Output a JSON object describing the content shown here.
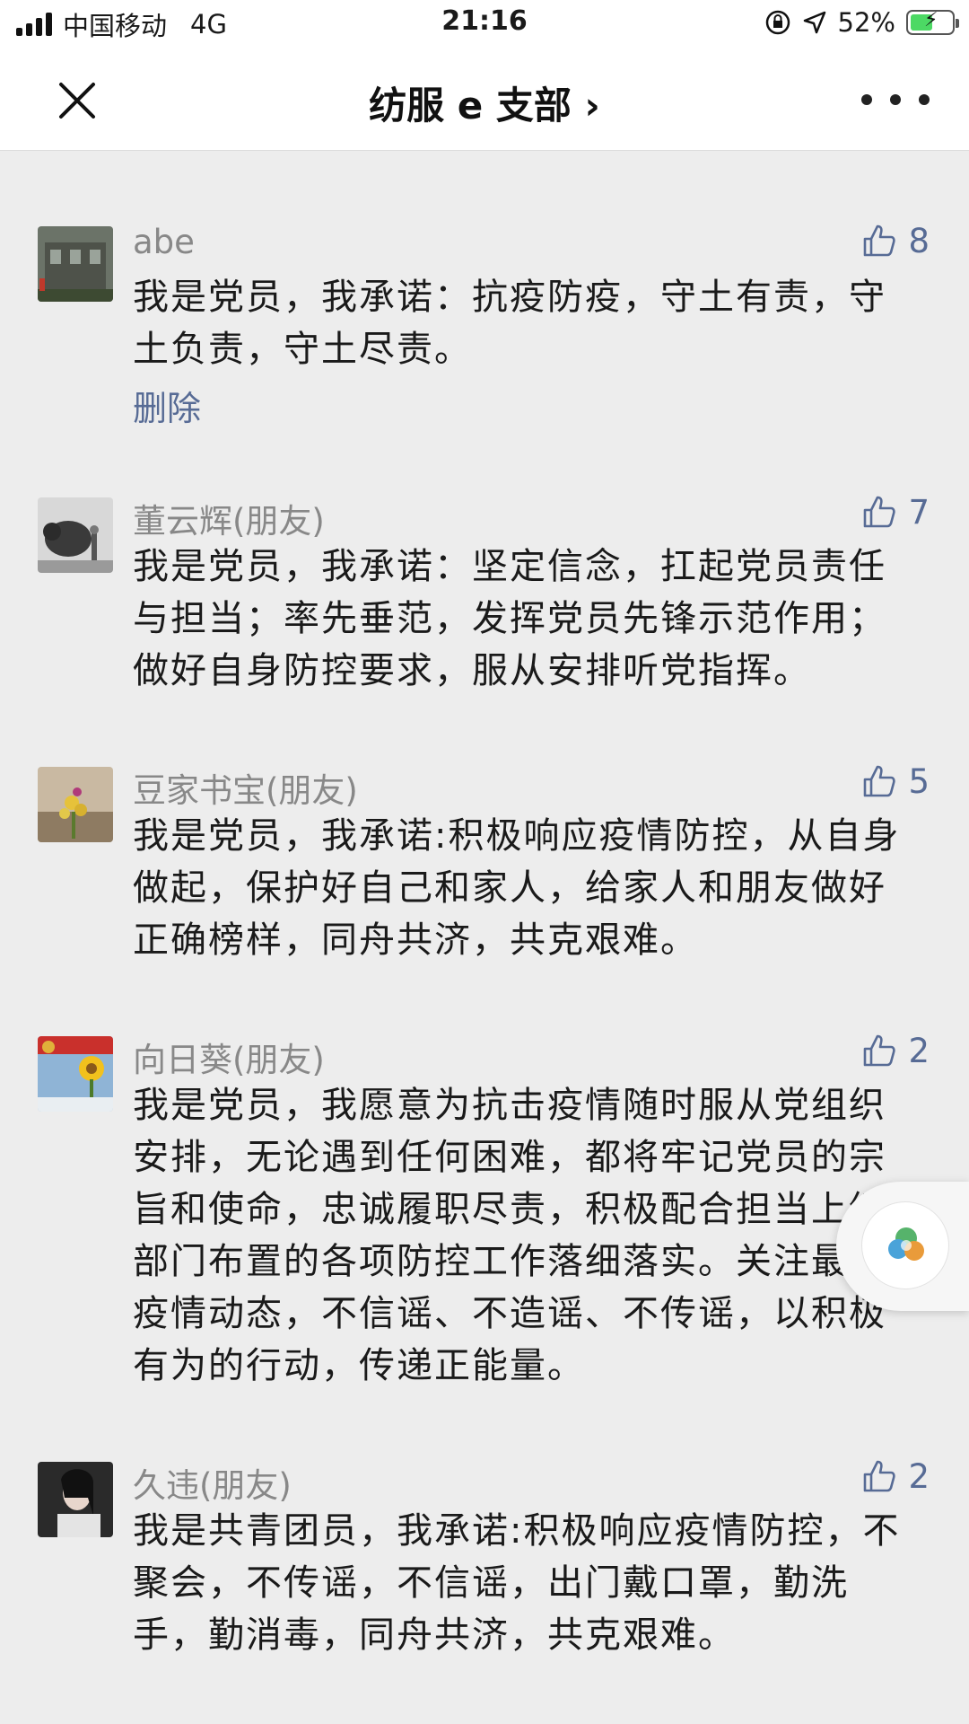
{
  "status_bar": {
    "carrier": "中国移动",
    "network": "4G",
    "time": "21:16",
    "battery": "52%",
    "battery_level": 0.52
  },
  "nav": {
    "title": "纺服 e 支部 ›"
  },
  "comments": [
    {
      "name": "abe",
      "likes": "8",
      "text": "我是党员，我承诺：抗疫防疫，守土有责，守土负责，守土尽责。",
      "delete_label": "删除"
    },
    {
      "name": "董云辉(朋友)",
      "likes": "7",
      "text": "我是党员，我承诺：坚定信念，扛起党员责任与担当；率先垂范，发挥党员先锋示范作用；做好自身防控要求，服从安排听党指挥。"
    },
    {
      "name": "豆家书宝(朋友)",
      "likes": "5",
      "text": "我是党员，我承诺:积极响应疫情防控，从自身做起，保护好自己和家人，给家人和朋友做好正确榜样，同舟共济，共克艰难。"
    },
    {
      "name": "向日葵(朋友)",
      "likes": "2",
      "text": "我是党员，我愿意为抗击疫情随时服从党组织安排，无论遇到任何困难，都将牢记党员的宗旨和使命，忠诚履职尽责，积极配合担当上级部门布置的各项防控工作落细落实。关注最新疫情动态，不信谣、不造谣、不传谣，以积极有为的行动，传递正能量。"
    },
    {
      "name": "久违(朋友)",
      "likes": "2",
      "text": "我是共青团员，我承诺:积极响应疫情防控，不聚会，不传谣，不信谣，出门戴口罩，勤洗手，勤消毒，同舟共济，共克艰难。"
    }
  ]
}
